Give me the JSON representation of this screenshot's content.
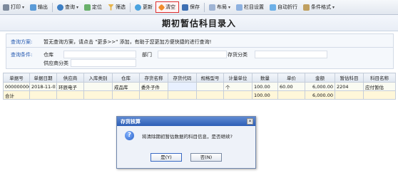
{
  "toolbar": {
    "items": [
      {
        "label": "打印",
        "icon": "printer-icon",
        "dropdown": true
      },
      {
        "label": "输出",
        "icon": "export-icon",
        "dropdown": false
      },
      {
        "label": "查询",
        "icon": "query-icon",
        "dropdown": true
      },
      {
        "label": "定位",
        "icon": "locate-icon",
        "dropdown": false
      },
      {
        "label": "筛选",
        "icon": "filter-icon",
        "dropdown": false
      },
      {
        "label": "更新",
        "icon": "refresh-icon",
        "dropdown": false
      },
      {
        "label": "清空",
        "icon": "clear-icon",
        "dropdown": false
      },
      {
        "label": "保存",
        "icon": "save-icon",
        "dropdown": false
      },
      {
        "label": "布局",
        "icon": "layout-icon",
        "dropdown": true
      },
      {
        "label": "栏目设置",
        "icon": "column-settings-icon",
        "dropdown": false
      },
      {
        "label": "自动折行",
        "icon": "word-wrap-icon",
        "dropdown": false
      },
      {
        "label": "条件格式",
        "icon": "conditional-format-icon",
        "dropdown": true
      }
    ],
    "active_item": "清空"
  },
  "page": {
    "title": "期初暂估科目录入"
  },
  "query": {
    "scheme_label": "查询方案:",
    "scheme_hint": "暂无查询方案，请点击 \"更多>>\" 添加，有助于您更加方便快捷的进行查询!",
    "condition_label": "查询条件:",
    "fields": {
      "warehouse": "仓库",
      "department": "部门",
      "inventory_class": "存货分类",
      "supplier_class": "供应商分类"
    }
  },
  "grid": {
    "columns": [
      "单据号",
      "单据日期",
      "供应商",
      "入库类别",
      "仓库",
      "存货名称",
      "存货代码",
      "规格型号",
      "计量单位",
      "数量",
      "单价",
      "金额",
      "暂估科目",
      "科目名称"
    ],
    "rows": [
      [
        "0000000003",
        "2018-11-01",
        "环辰电子",
        "",
        "成品库",
        "委外子件",
        "",
        "",
        "个",
        "100.00",
        "60.00",
        "6,000.00",
        "2204",
        "应付暂估"
      ]
    ],
    "total": [
      "合计",
      "",
      "",
      "",
      "",
      "",
      "",
      "",
      "",
      "100.00",
      "",
      "6,000.00",
      "",
      ""
    ]
  },
  "dialog": {
    "title": "存货核算",
    "message": "将清除期初暂估数据的科目信息，是否继续?",
    "yes_label": "是(Y)",
    "no_label": "否(N)",
    "close_glyph": "×"
  },
  "colors": {
    "title_bar": "#2d5eb6",
    "active_border": "#e03030",
    "query_label": "#2358b0"
  }
}
